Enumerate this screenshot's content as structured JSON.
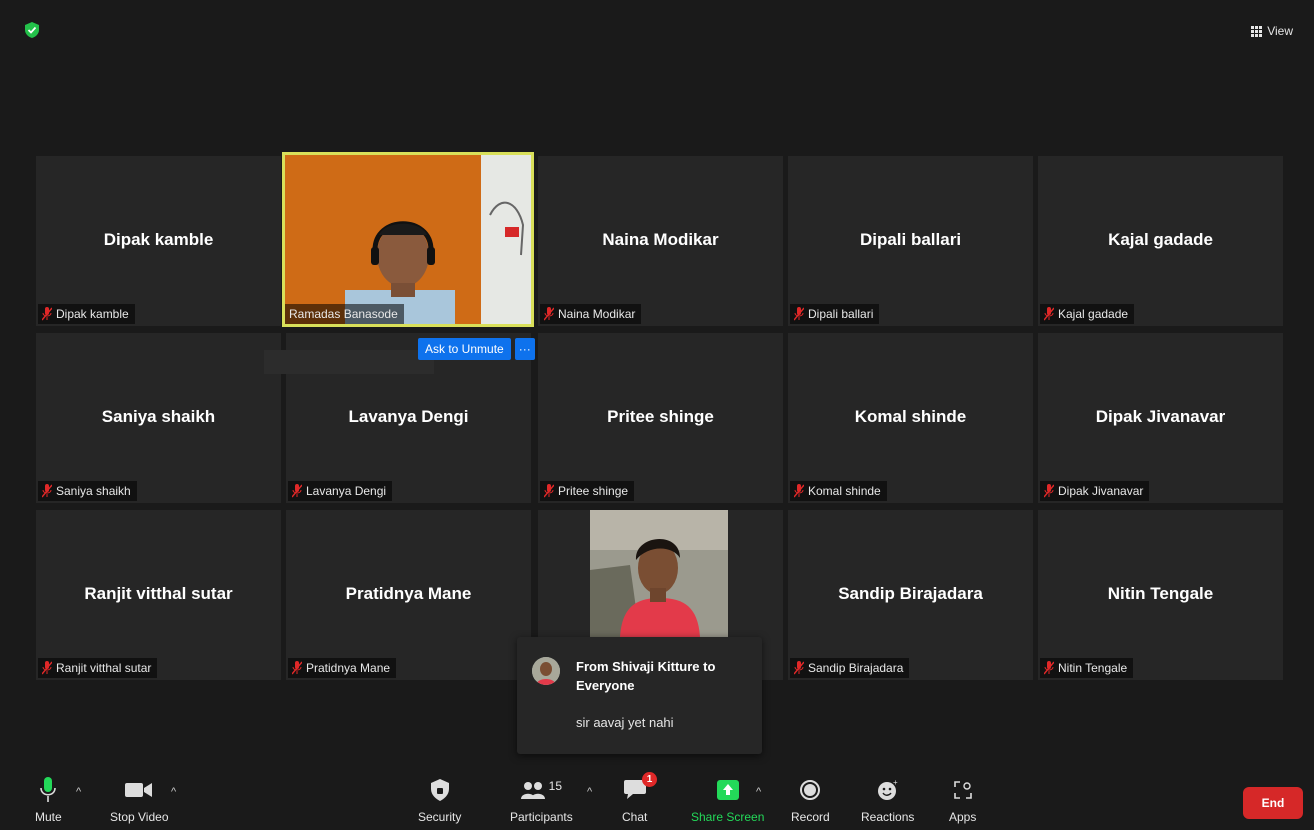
{
  "header": {
    "view_label": "View"
  },
  "tiles": [
    {
      "name": "Dipak kamble",
      "label": "Dipak kamble"
    },
    {
      "name": "",
      "label": "Ramadas Banasode"
    },
    {
      "name": "Naina Modikar",
      "label": "Naina Modikar"
    },
    {
      "name": "Dipali ballari",
      "label": "Dipali ballari"
    },
    {
      "name": "Kajal gadade",
      "label": "Kajal gadade"
    },
    {
      "name": "Saniya shaikh",
      "label": "Saniya shaikh"
    },
    {
      "name": "Lavanya Dengi",
      "label": "Lavanya Dengi"
    },
    {
      "name": "Pritee shinge",
      "label": "Pritee shinge"
    },
    {
      "name": "Komal shinde",
      "label": "Komal shinde"
    },
    {
      "name": "Dipak Jivanavar",
      "label": "Dipak Jivanavar"
    },
    {
      "name": "Ranjit vitthal sutar",
      "label": "Ranjit vitthal sutar"
    },
    {
      "name": "Pratidnya  Mane",
      "label": "Pratidnya  Mane"
    },
    {
      "name": "",
      "label": ""
    },
    {
      "name": "Sandip Birajadara",
      "label": "Sandip Birajadara"
    },
    {
      "name": "Nitin Tengale",
      "label": "Nitin Tengale"
    }
  ],
  "video_controls": {
    "ask_to_unmute": "Ask to Unmute",
    "more": "···"
  },
  "chat_toast": {
    "from": "From Shivaji Kitture to Everyone",
    "message": "sir aavaj yet nahi"
  },
  "toolbar": {
    "mute": "Mute",
    "stop_video": "Stop Video",
    "security": "Security",
    "participants": "Participants",
    "participants_count": "15",
    "chat": "Chat",
    "chat_badge": "1",
    "share_screen": "Share Screen",
    "record": "Record",
    "reactions": "Reactions",
    "apps": "Apps",
    "end": "End"
  },
  "colors": {
    "background": "#1a1a1a",
    "tile": "#262626",
    "accent_blue": "#0e72ed",
    "share_green": "#23d959",
    "end_red": "#d62828",
    "active_speaker": "#d9e05a",
    "mic_off_red": "#e02828"
  }
}
